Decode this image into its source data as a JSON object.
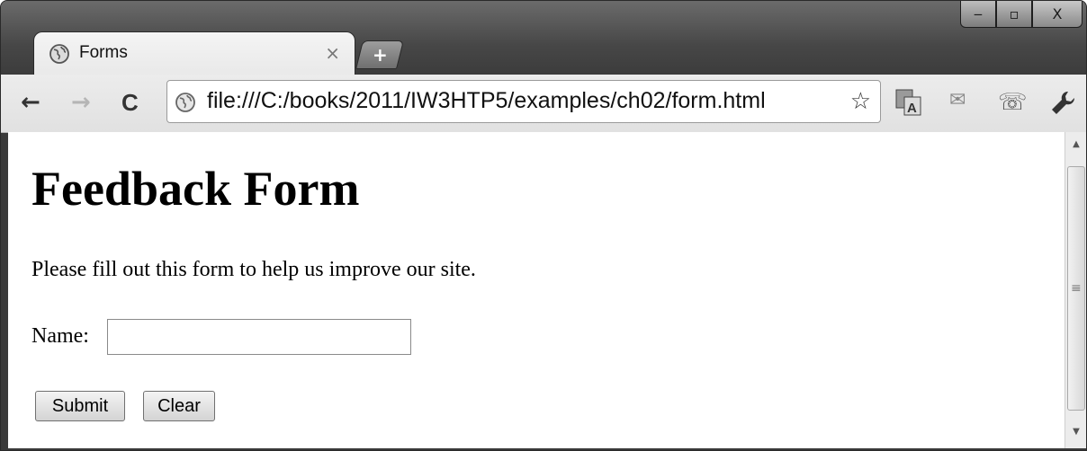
{
  "window": {
    "minimize": "‒",
    "maximize": "▫",
    "close": "X"
  },
  "tab": {
    "title": "Forms",
    "close": "×",
    "icon": "globe-icon"
  },
  "newtab": {
    "label": "+"
  },
  "toolbar": {
    "back": "←",
    "forward": "→",
    "reload": "C",
    "url": "file:///C:/books/2011/IW3HTP5/examples/ch02/form.html",
    "star": "☆",
    "ext_translate": "translate-icon",
    "ext_mail": "✉",
    "ext_phone": "☏",
    "wrench": "🔧"
  },
  "page": {
    "heading": "Feedback Form",
    "intro": "Please fill out this form to help us improve our site.",
    "name_label": "Name:",
    "name_value": "",
    "submit_label": "Submit",
    "clear_label": "Clear"
  },
  "scrollbar": {
    "up": "▲",
    "down": "▼",
    "grip": "≡"
  }
}
